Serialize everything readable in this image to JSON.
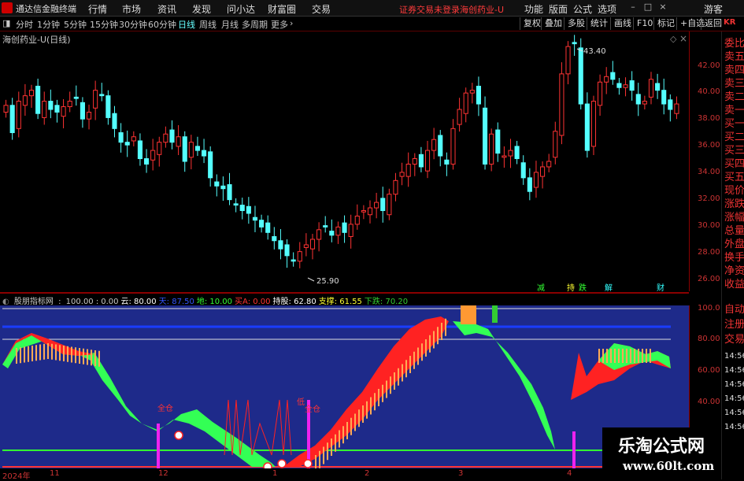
{
  "titlebar": {
    "app_name": "通达信金融终端",
    "menus": [
      "行情",
      "市场",
      "资讯",
      "发现",
      "问小达",
      "财富圈",
      "交易"
    ],
    "warning": "证券交易未登录",
    "stock_tab": "海创药业-U",
    "right_menus": [
      "功能",
      "版面",
      "公式",
      "选项"
    ],
    "guest": "游客"
  },
  "toolbar": {
    "periods": [
      "分时",
      "1分钟",
      "5分钟",
      "15分钟",
      "30分钟",
      "60分钟",
      "日线",
      "周线",
      "月线",
      "多周期",
      "更多"
    ],
    "active_period": "日线",
    "right_buttons": [
      "复权",
      "叠加",
      "多股",
      "统计",
      "画线",
      "F10",
      "标记",
      "+自选",
      "返回"
    ]
  },
  "main_chart": {
    "title": "海创药业-U(日线)",
    "high_marker": "43.40",
    "low_marker": "25.90",
    "price_ticks": [
      "42.00",
      "40.00",
      "38.00",
      "36.00",
      "34.00",
      "32.00",
      "30.00",
      "28.00",
      "26.00"
    ],
    "signals": [
      "减",
      "持",
      "跌",
      "解",
      "财"
    ]
  },
  "right_panel": {
    "labels": [
      "委比",
      "卖五",
      "卖四",
      "卖三",
      "卖二",
      "卖一",
      "买一",
      "买二",
      "买三",
      "买四",
      "买五",
      "现价",
      "涨跌",
      "涨幅",
      "总量",
      "外盘",
      "换手",
      "净资",
      "收益"
    ],
    "lower_labels": [
      "自动",
      "注册",
      "交易"
    ],
    "times": [
      "14:56",
      "14:56",
      "14:56",
      "14:56",
      "14:56",
      "14:56"
    ],
    "top_badge": "KR"
  },
  "indicator": {
    "name": "股朋指标网",
    "values": [
      {
        "label": "100.00",
        "color": "#c8c8c8"
      },
      {
        "label": "0.00",
        "color": "#c8c8c8"
      },
      {
        "label": "云: 80.00",
        "color": "#ffffff"
      },
      {
        "label": "天: 87.50",
        "color": "#3355ff"
      },
      {
        "label": "地: 10.00",
        "color": "#33ff33"
      },
      {
        "label": "买A: 0.00",
        "color": "#ff3333"
      },
      {
        "label": "持股: 62.80",
        "color": "#ffffff"
      },
      {
        "label": "支撑: 61.55",
        "color": "#ffff33"
      },
      {
        "label": "下跌: 70.20",
        "color": "#33cc33"
      }
    ],
    "axis_ticks": [
      "100.0",
      "80.00",
      "60.00",
      "40.00"
    ],
    "labels_on_chart": [
      "全仓",
      "低",
      "全仓"
    ]
  },
  "time_axis": [
    "2024年",
    "11",
    "12",
    "1",
    "2",
    "3",
    "4"
  ],
  "watermark": {
    "line1": "乐淘公式网",
    "line2": "www.60lt.com"
  },
  "colors": {
    "up": "#ff3333",
    "down": "#54ffff",
    "background": "#000000",
    "indicator_bg": "#1e2a8a"
  }
}
